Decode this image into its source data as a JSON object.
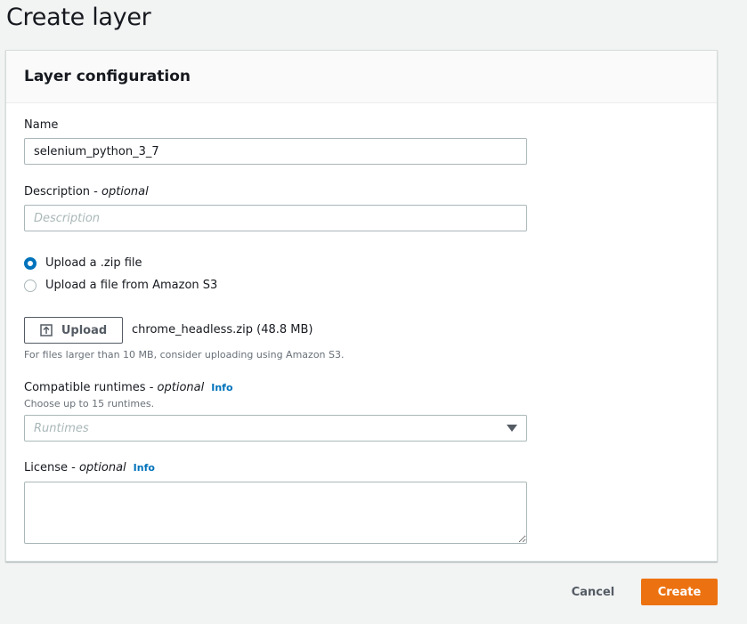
{
  "page": {
    "title": "Create layer"
  },
  "panel": {
    "title": "Layer configuration",
    "name": {
      "label": "Name",
      "value": "selenium_python_3_7"
    },
    "description": {
      "label": "Description - ",
      "optional": "optional",
      "placeholder": "Description"
    },
    "upload_options": {
      "zip": {
        "label": "Upload a .zip file",
        "selected": true
      },
      "s3": {
        "label": "Upload a file from Amazon S3",
        "selected": false
      }
    },
    "upload": {
      "button_label": "Upload",
      "file_name": "chrome_headless.zip (48.8 MB)",
      "hint": "For files larger than 10 MB, consider uploading using Amazon S3."
    },
    "runtimes": {
      "label": "Compatible runtimes - ",
      "optional": "optional",
      "info": "Info",
      "hint": "Choose up to 15 runtimes.",
      "placeholder": "Runtimes"
    },
    "license": {
      "label": "License - ",
      "optional": "optional",
      "info": "Info",
      "value": ""
    }
  },
  "footer": {
    "cancel_label": "Cancel",
    "create_label": "Create"
  },
  "colors": {
    "accent": "#0073bb",
    "primary_button": "#ec7211",
    "background": "#f2f3f3"
  }
}
